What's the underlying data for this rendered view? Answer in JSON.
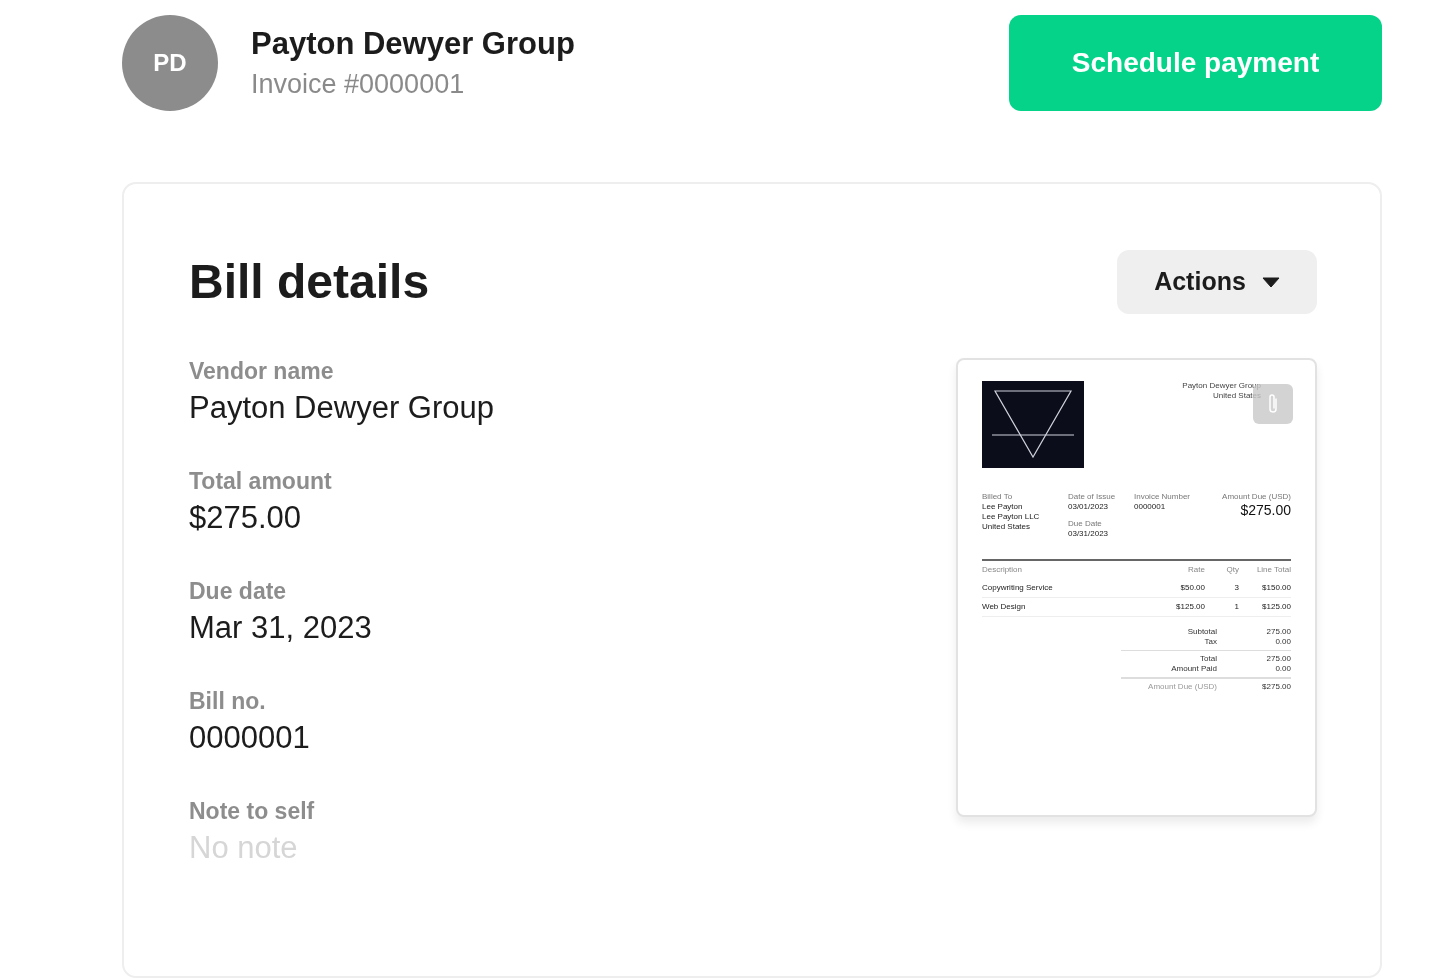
{
  "header": {
    "avatar_initials": "PD",
    "vendor": "Payton Dewyer Group",
    "invoice_label": "Invoice #0000001",
    "primary_button": "Schedule payment"
  },
  "card": {
    "title": "Bill details",
    "actions_button": "Actions",
    "fields": [
      {
        "label": "Vendor name",
        "value": "Payton Dewyer Group"
      },
      {
        "label": "Total amount",
        "value": "$275.00"
      },
      {
        "label": "Due date",
        "value": "Mar 31, 2023"
      },
      {
        "label": "Bill no.",
        "value": "0000001"
      },
      {
        "label": "Note to self",
        "placeholder": "No note"
      }
    ],
    "document": {
      "sender_lines": [
        "Payton Dewyer Group",
        "United States"
      ],
      "billed_to": {
        "label": "Billed To",
        "lines": [
          "Lee Payton",
          "Lee Payton LLC",
          "United States"
        ]
      },
      "date_of_issue": {
        "label": "Date of Issue",
        "value": "03/01/2023"
      },
      "due_date": {
        "label": "Due Date",
        "value": "03/31/2023"
      },
      "invoice_number": {
        "label": "Invoice Number",
        "value": "0000001"
      },
      "amount_due": {
        "label": "Amount Due (USD)",
        "value": "$275.00"
      },
      "columns": [
        "Description",
        "Rate",
        "Qty",
        "Line Total"
      ],
      "rows": [
        [
          "Copywriting Service",
          "$50.00",
          "3",
          "$150.00"
        ],
        [
          "Web Design",
          "$125.00",
          "1",
          "$125.00"
        ]
      ],
      "totals": [
        {
          "label": "Subtotal",
          "value": "275.00"
        },
        {
          "label": "Tax",
          "value": "0.00"
        },
        {
          "label": "Total",
          "value": "275.00"
        },
        {
          "label": "Amount Paid",
          "value": "0.00"
        },
        {
          "label": "Amount Due (USD)",
          "value": "$275.00"
        }
      ]
    }
  }
}
